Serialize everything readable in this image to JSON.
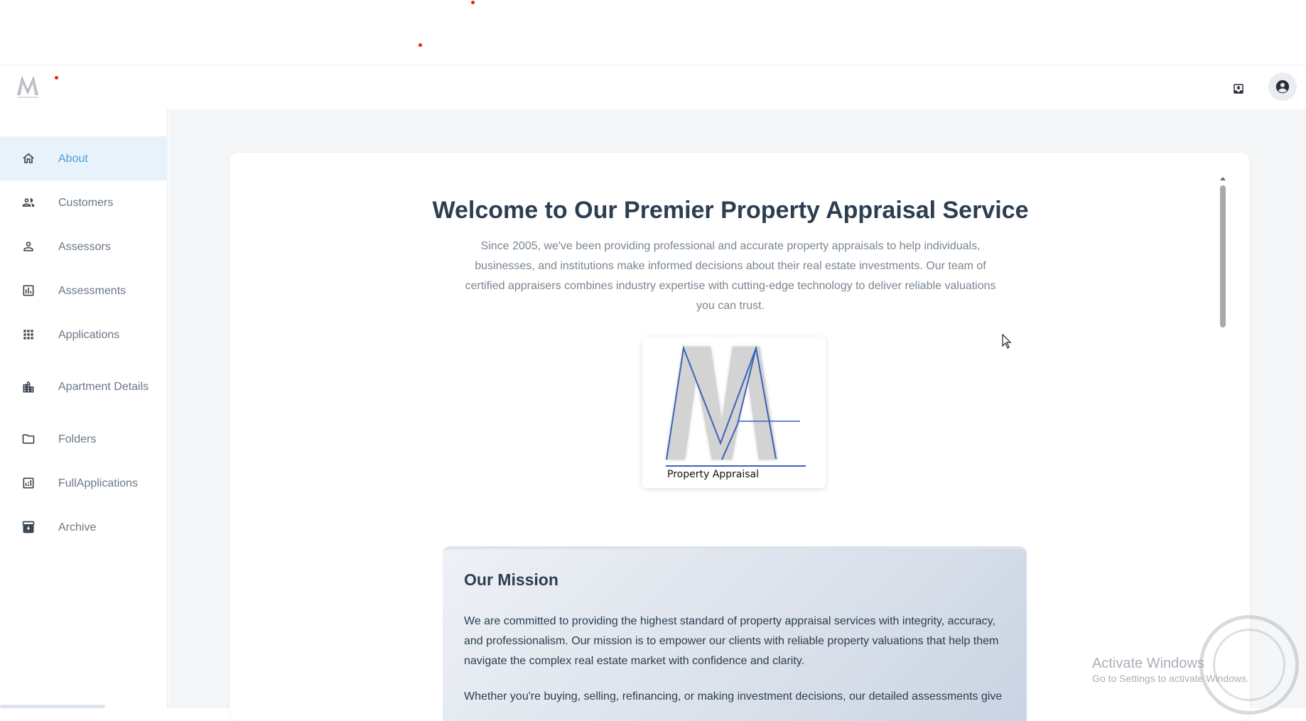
{
  "topbar": {
    "logo_icon": "app-logo-icon",
    "actions": [
      {
        "name": "inbox-download-icon"
      },
      {
        "name": "account-circle-icon"
      }
    ]
  },
  "sidebar": {
    "items": [
      {
        "label": "About",
        "icon": "home-icon",
        "active": true
      },
      {
        "label": "Customers",
        "icon": "people-icon",
        "active": false
      },
      {
        "label": "Assessors",
        "icon": "person-icon",
        "active": false
      },
      {
        "label": "Assessments",
        "icon": "bar-chart-icon",
        "active": false
      },
      {
        "label": "Applications",
        "icon": "apps-grid-icon",
        "active": false
      },
      {
        "label": "Apartment Details",
        "icon": "building-icon",
        "active": false
      },
      {
        "label": "Folders",
        "icon": "folder-icon",
        "active": false
      },
      {
        "label": "FullApplications",
        "icon": "analytics-icon",
        "active": false
      },
      {
        "label": "Archive",
        "icon": "archive-icon",
        "active": false
      }
    ]
  },
  "main": {
    "title": "Welcome to Our Premier Property Appraisal Service",
    "description": "Since 2005, we've been providing professional and accurate property appraisals to help individuals, businesses, and institutions make informed decisions about their real estate investments. Our team of certified appraisers combines industry expertise with cutting-edge technology to deliver reliable valuations you can trust.",
    "logo_label": "Property Appraisal",
    "mission": {
      "title": "Our Mission",
      "paragraph1": "We are committed to providing the highest standard of property appraisal services with integrity, accuracy, and professionalism. Our mission is to empower our clients with reliable property valuations that help them navigate the complex real estate market with confidence and clarity.",
      "paragraph2": "Whether you're buying, selling, refinancing, or making investment decisions, our detailed assessments give"
    }
  },
  "watermark": {
    "title": "Activate Windows",
    "subtitle": "Go to Settings to activate Windows."
  },
  "colors": {
    "accent": "#4a9fdc",
    "active_bg": "#e8f2fb",
    "heading": "#2c3e50",
    "muted_text": "#7a8591",
    "logo_blue": "#3b63b8"
  }
}
